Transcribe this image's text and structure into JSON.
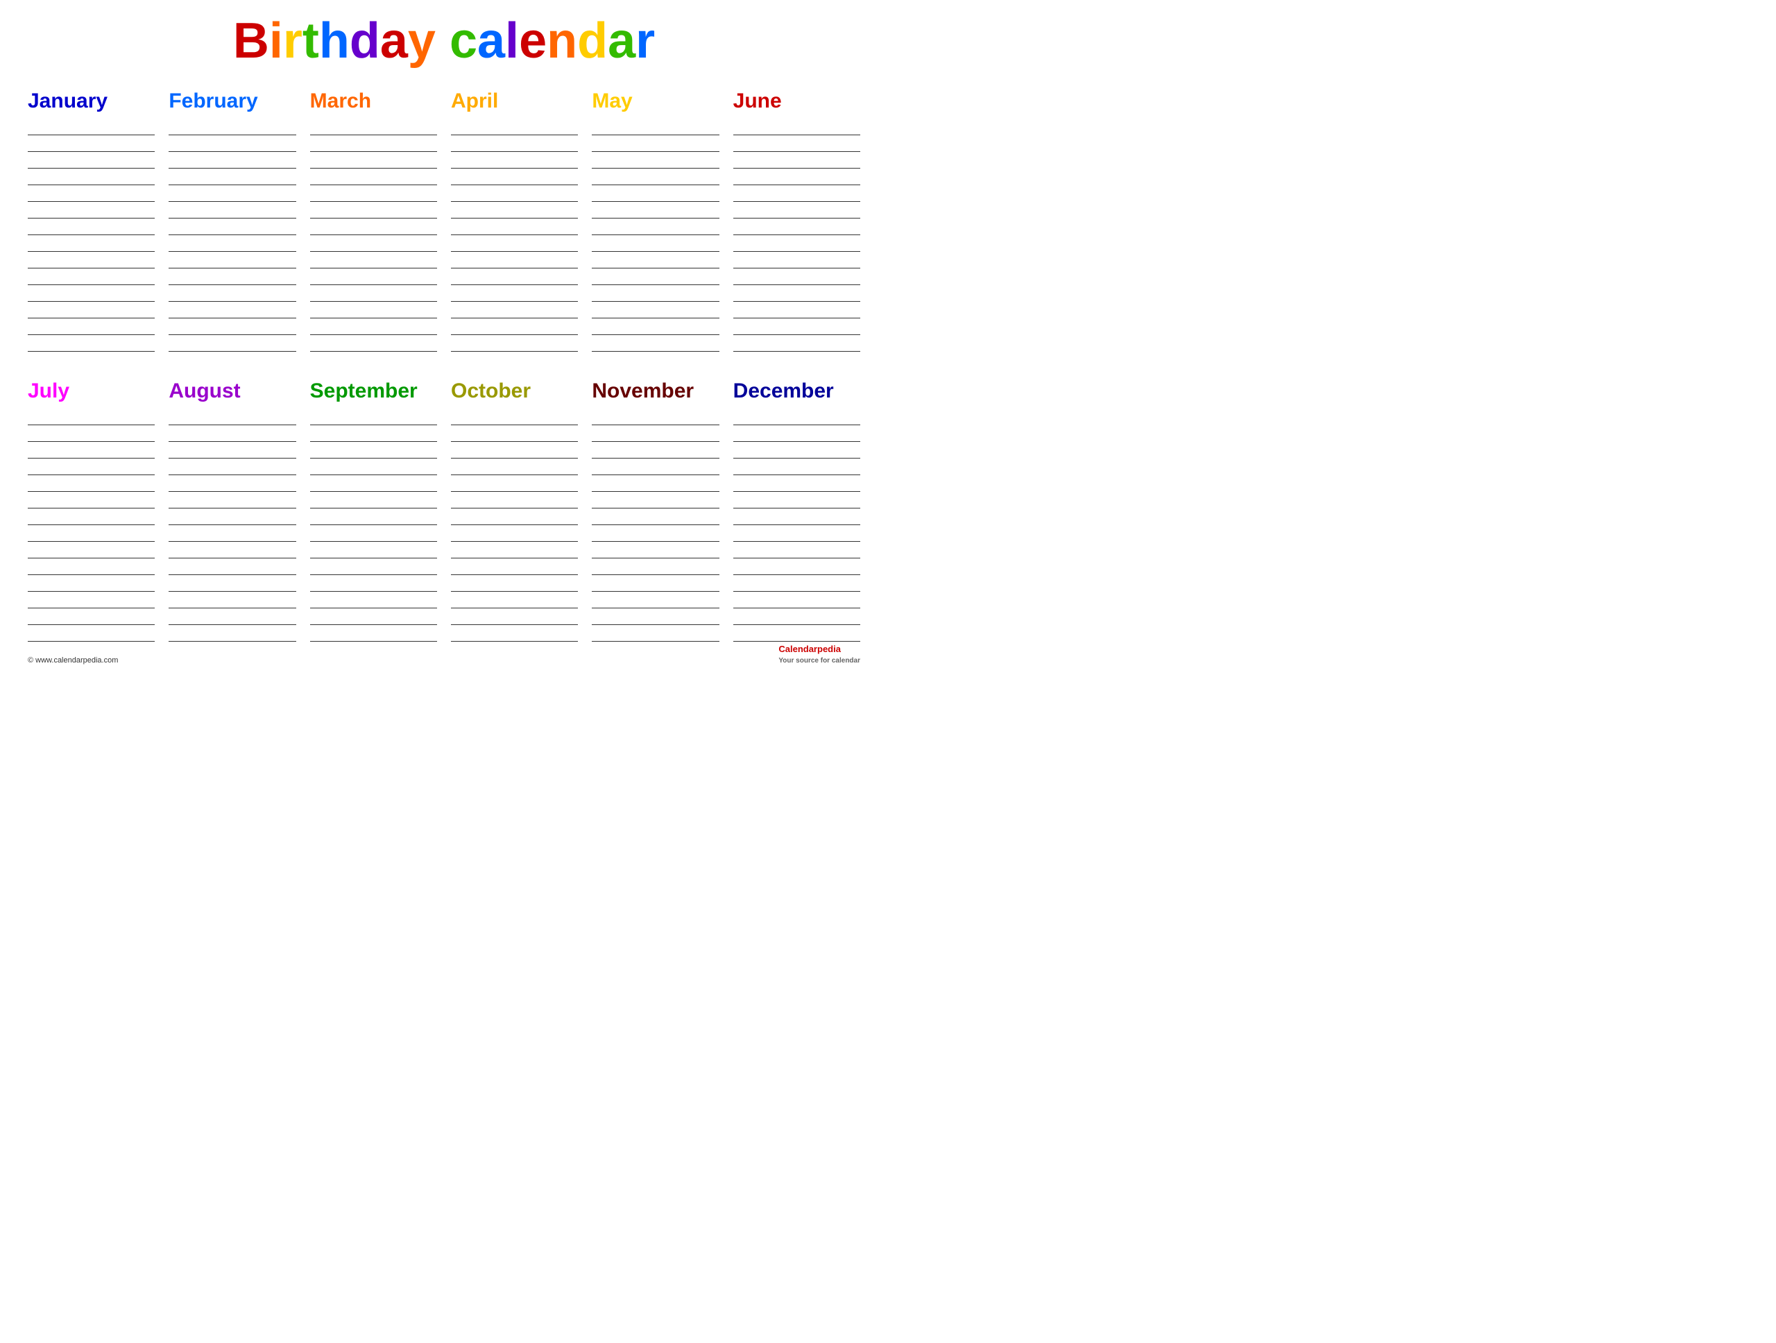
{
  "title": {
    "text": "Birthday calendar",
    "letters": [
      {
        "char": "B",
        "color": "#cc0000"
      },
      {
        "char": "i",
        "color": "#ff6600"
      },
      {
        "char": "r",
        "color": "#ffcc00"
      },
      {
        "char": "t",
        "color": "#33bb00"
      },
      {
        "char": "h",
        "color": "#0066ff"
      },
      {
        "char": "d",
        "color": "#6600cc"
      },
      {
        "char": "a",
        "color": "#cc0000"
      },
      {
        "char": "y",
        "color": "#ff6600"
      },
      {
        "char": " ",
        "color": "#000"
      },
      {
        "char": "c",
        "color": "#33bb00"
      },
      {
        "char": "a",
        "color": "#0066ff"
      },
      {
        "char": "l",
        "color": "#6600cc"
      },
      {
        "char": "e",
        "color": "#cc0000"
      },
      {
        "char": "n",
        "color": "#ff6600"
      },
      {
        "char": "d",
        "color": "#ffcc00"
      },
      {
        "char": "a",
        "color": "#33bb00"
      },
      {
        "char": "r",
        "color": "#0066ff"
      }
    ]
  },
  "months": [
    {
      "name": "January",
      "color": "#0000cc",
      "lines": 14
    },
    {
      "name": "February",
      "color": "#0066ff",
      "lines": 14
    },
    {
      "name": "March",
      "color": "#ff6600",
      "lines": 14
    },
    {
      "name": "April",
      "color": "#ffaa00",
      "lines": 14
    },
    {
      "name": "May",
      "color": "#ddcc00",
      "lines": 14
    },
    {
      "name": "June",
      "color": "#cc0000",
      "lines": 14
    },
    {
      "name": "July",
      "color": "#ff00ff",
      "lines": 14
    },
    {
      "name": "August",
      "color": "#9900cc",
      "lines": 14
    },
    {
      "name": "September",
      "color": "#009900",
      "lines": 14
    },
    {
      "name": "October",
      "color": "#999900",
      "lines": 14
    },
    {
      "name": "November",
      "color": "#660000",
      "lines": 14
    },
    {
      "name": "December",
      "color": "#000099",
      "lines": 14
    }
  ],
  "footer": {
    "left": "© www.calendarpedia.com",
    "right_plain": "Calendar",
    "right_bold": "pedia",
    "right_sub": "Your source for calendar"
  }
}
